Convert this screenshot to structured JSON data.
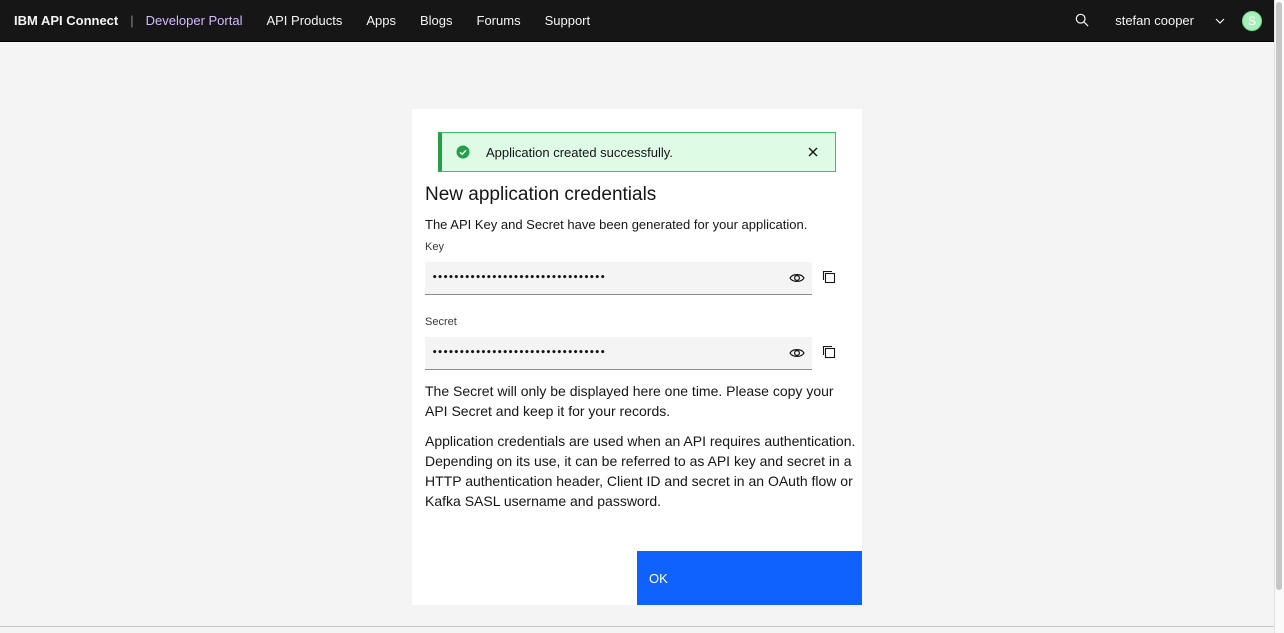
{
  "header": {
    "brand": "IBM API Connect",
    "separator": "|",
    "portal": "Developer Portal",
    "nav": [
      "API Products",
      "Apps",
      "Blogs",
      "Forums",
      "Support"
    ],
    "user_name": "stefan cooper",
    "avatar_initial": "S"
  },
  "modal": {
    "toast_message": "Application created successfully.",
    "title": "New application credentials",
    "subtitle": "The API Key and Secret have been generated for your application.",
    "key_label": "Key",
    "key_value": "••••••••••••••••••••••••••••••••",
    "secret_label": "Secret",
    "secret_value": "••••••••••••••••••••••••••••••••",
    "secret_notice": "The Secret will only be displayed here one time. Please copy your API Secret and keep it for your records.",
    "info_text": "Application credentials are used when an API requires authentication. Depending on its use, it can be referred to as API key and secret in a HTTP authentication header, Client ID and secret in an OAuth flow or Kafka SASL username and password.",
    "ok_label": "OK"
  },
  "colors": {
    "header_bg": "#161616",
    "portal_link": "#d4bbff",
    "success_bg": "#defbe6",
    "success_accent": "#24a148",
    "primary_button": "#0f62fe"
  },
  "icons": [
    "search-icon",
    "chevron-down-icon",
    "checkmark-filled-icon",
    "close-icon",
    "eye-icon",
    "copy-icon"
  ]
}
